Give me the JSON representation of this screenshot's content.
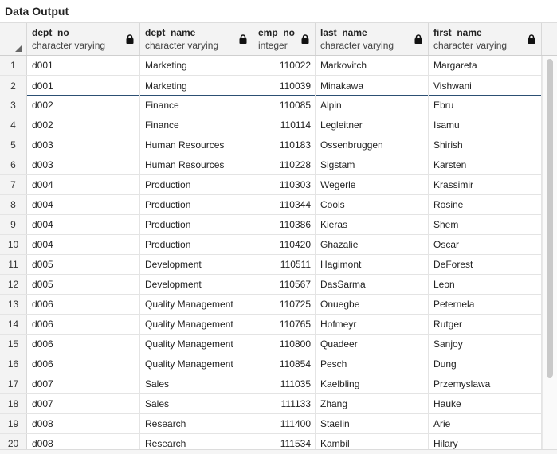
{
  "panel": {
    "title": "Data Output"
  },
  "columns": [
    {
      "name": "dept_no",
      "type": "character varying",
      "locked": true
    },
    {
      "name": "dept_name",
      "type": "character varying",
      "locked": true
    },
    {
      "name": "emp_no",
      "type": "integer",
      "locked": true
    },
    {
      "name": "last_name",
      "type": "character varying",
      "locked": true
    },
    {
      "name": "first_name",
      "type": "character varying",
      "locked": true
    }
  ],
  "selected_row": 2,
  "rows": [
    [
      "1",
      "d001",
      "Marketing",
      "110022",
      "Markovitch",
      "Margareta"
    ],
    [
      "2",
      "d001",
      "Marketing",
      "110039",
      "Minakawa",
      "Vishwani"
    ],
    [
      "3",
      "d002",
      "Finance",
      "110085",
      "Alpin",
      "Ebru"
    ],
    [
      "4",
      "d002",
      "Finance",
      "110114",
      "Legleitner",
      "Isamu"
    ],
    [
      "5",
      "d003",
      "Human Resources",
      "110183",
      "Ossenbruggen",
      "Shirish"
    ],
    [
      "6",
      "d003",
      "Human Resources",
      "110228",
      "Sigstam",
      "Karsten"
    ],
    [
      "7",
      "d004",
      "Production",
      "110303",
      "Wegerle",
      "Krassimir"
    ],
    [
      "8",
      "d004",
      "Production",
      "110344",
      "Cools",
      "Rosine"
    ],
    [
      "9",
      "d004",
      "Production",
      "110386",
      "Kieras",
      "Shem"
    ],
    [
      "10",
      "d004",
      "Production",
      "110420",
      "Ghazalie",
      "Oscar"
    ],
    [
      "11",
      "d005",
      "Development",
      "110511",
      "Hagimont",
      "DeForest"
    ],
    [
      "12",
      "d005",
      "Development",
      "110567",
      "DasSarma",
      "Leon"
    ],
    [
      "13",
      "d006",
      "Quality Management",
      "110725",
      "Onuegbe",
      "Peternela"
    ],
    [
      "14",
      "d006",
      "Quality Management",
      "110765",
      "Hofmeyr",
      "Rutger"
    ],
    [
      "15",
      "d006",
      "Quality Management",
      "110800",
      "Quadeer",
      "Sanjoy"
    ],
    [
      "16",
      "d006",
      "Quality Management",
      "110854",
      "Pesch",
      "Dung"
    ],
    [
      "17",
      "d007",
      "Sales",
      "111035",
      "Kaelbling",
      "Przemyslawa"
    ],
    [
      "18",
      "d007",
      "Sales",
      "111133",
      "Zhang",
      "Hauke"
    ],
    [
      "19",
      "d008",
      "Research",
      "111400",
      "Staelin",
      "Arie"
    ],
    [
      "20",
      "d008",
      "Research",
      "111534",
      "Kambil",
      "Hilary"
    ]
  ]
}
